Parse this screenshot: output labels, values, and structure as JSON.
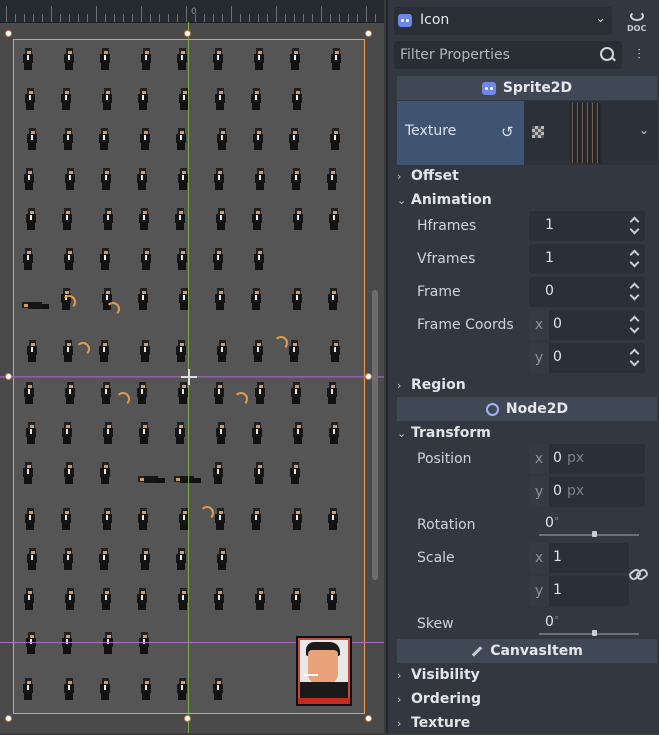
{
  "viewport": {
    "ruler_zero_label": "0"
  },
  "inspector": {
    "node_selector": {
      "label": "Icon",
      "icon": "godot-node-icon"
    },
    "doc_button_icon": "doc-icon",
    "filter": {
      "placeholder": "Filter Properties",
      "value": ""
    },
    "sections": {
      "sprite2d": {
        "title": "Sprite2D",
        "icon": "godot-icon"
      },
      "node2d": {
        "title": "Node2D",
        "icon": "circle-icon"
      },
      "canvasitem": {
        "title": "CanvasItem",
        "icon": "pencil-icon"
      }
    },
    "texture": {
      "label": "Texture"
    },
    "groups": {
      "offset": "Offset",
      "animation": "Animation",
      "region": "Region",
      "transform": "Transform",
      "visibility": "Visibility",
      "ordering": "Ordering",
      "texture": "Texture"
    },
    "animation": {
      "hframes": {
        "label": "Hframes",
        "value": "1"
      },
      "vframes": {
        "label": "Vframes",
        "value": "1"
      },
      "frame": {
        "label": "Frame",
        "value": "0"
      },
      "frame_coords": {
        "label": "Frame Coords",
        "x": "0",
        "y": "0"
      }
    },
    "transform": {
      "position": {
        "label": "Position",
        "x": "0",
        "y": "0",
        "unit": "px"
      },
      "rotation": {
        "label": "Rotation",
        "value": "0",
        "unit": "°",
        "slider_fraction": 0.55
      },
      "scale": {
        "label": "Scale",
        "x": "1",
        "y": "1"
      },
      "skew": {
        "label": "Skew",
        "value": "0",
        "unit": "°",
        "slider_fraction": 0.55
      }
    },
    "axis_labels": {
      "x": "x",
      "y": "y"
    },
    "arrows": {
      "collapsed": "›",
      "expanded": "⌄"
    }
  }
}
